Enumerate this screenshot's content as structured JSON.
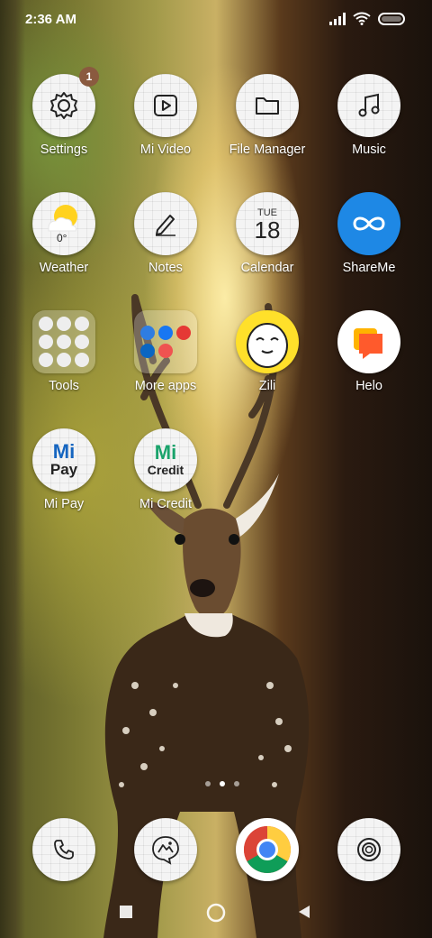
{
  "status_bar": {
    "time": "2:36 AM",
    "icons": [
      "signal-icon",
      "wifi-icon",
      "battery-icon"
    ]
  },
  "apps": [
    {
      "name": "settings",
      "label": "Settings",
      "icon": "gear-icon",
      "badge": "1"
    },
    {
      "name": "mi-video",
      "label": "Mi Video",
      "icon": "play-icon"
    },
    {
      "name": "file-manager",
      "label": "File Manager",
      "icon": "folder-icon"
    },
    {
      "name": "music",
      "label": "Music",
      "icon": "music-note-icon"
    },
    {
      "name": "weather",
      "label": "Weather",
      "icon": "sun-cloud-icon",
      "temp": "0°"
    },
    {
      "name": "notes",
      "label": "Notes",
      "icon": "pencil-icon"
    },
    {
      "name": "calendar",
      "label": "Calendar",
      "icon": "calendar-icon",
      "day": "TUE",
      "date": "18"
    },
    {
      "name": "shareme",
      "label": "ShareMe",
      "icon": "infinity-icon"
    },
    {
      "name": "tools-folder",
      "label": "Tools",
      "icon": "folder-grid-icon"
    },
    {
      "name": "more-apps-folder",
      "label": "More apps",
      "icon": "folder-grid-icon"
    },
    {
      "name": "zili",
      "label": "Zili",
      "icon": "zili-face-icon"
    },
    {
      "name": "helo",
      "label": "Helo",
      "icon": "chat-bubble-icon"
    },
    {
      "name": "mi-pay",
      "label": "Mi Pay",
      "icon": "mi-pay-logo",
      "logo_line1": "Mi",
      "logo_line2": "Pay"
    },
    {
      "name": "mi-credit",
      "label": "Mi Credit",
      "icon": "mi-credit-logo",
      "logo_line1": "Mi",
      "logo_line2": "Credit"
    }
  ],
  "dock": [
    {
      "name": "phone",
      "icon": "phone-icon"
    },
    {
      "name": "gallery",
      "icon": "gallery-icon"
    },
    {
      "name": "chrome",
      "icon": "chrome-icon"
    },
    {
      "name": "camera",
      "icon": "camera-icon"
    }
  ],
  "page_indicator": {
    "pages": 2,
    "active": 1
  },
  "navigation": [
    "recents-button",
    "home-button",
    "back-button"
  ],
  "colors": {
    "badge": "#8a5a3f",
    "shareme": "#1e88e5",
    "mi_blue": "#1565c0",
    "mi_green": "#1aa36b",
    "helo_orange": "#ff5a2c",
    "zili_yellow": "#ffe02a"
  }
}
